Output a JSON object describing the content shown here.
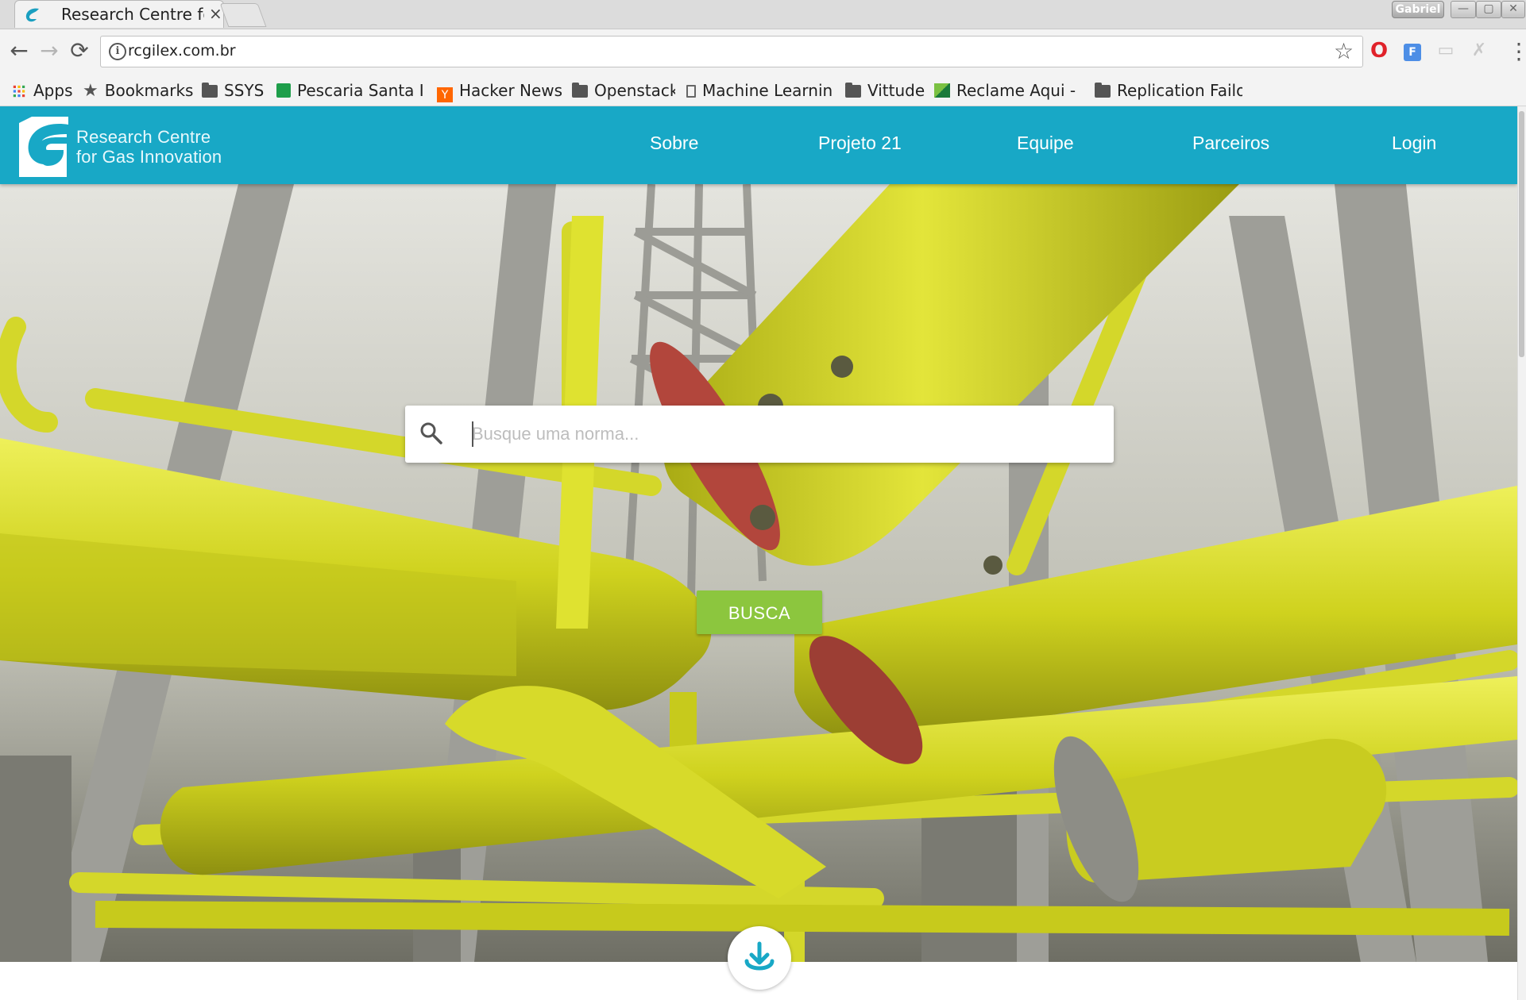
{
  "browser": {
    "tab_title": "Research Centre for",
    "tab_close": "×",
    "profile_name": "Gabriel",
    "window_buttons": [
      "—",
      "▢",
      "✕"
    ],
    "url": "rcgilex.com.br",
    "bookmarks": [
      {
        "label": "Apps",
        "icon": "apps-grid-icon"
      },
      {
        "label": "Bookmarks",
        "icon": "star-icon"
      },
      {
        "label": "SSYS",
        "icon": "folder-icon"
      },
      {
        "label": "Pescaria Santa I",
        "icon": "sheet-icon"
      },
      {
        "label": "Hacker News",
        "icon": "y-icon"
      },
      {
        "label": "Openstack",
        "icon": "folder-icon"
      },
      {
        "label": "Machine Learning",
        "icon": "page-icon"
      },
      {
        "label": "Vittude",
        "icon": "folder-icon"
      },
      {
        "label": "Reclame Aqui - S",
        "icon": "ra-icon"
      },
      {
        "label": "Replication Failo",
        "icon": "folder-icon"
      }
    ]
  },
  "site": {
    "logo_line1": "Research Centre",
    "logo_line2": "for Gas Innovation",
    "nav": [
      "Sobre",
      "Projeto 21",
      "Equipe",
      "Parceiros",
      "Login"
    ],
    "search_placeholder": "Busque uma norma...",
    "search_button": "BUSCA",
    "colors": {
      "header": "#18a8c6",
      "button": "#8cc63e",
      "pipes": "#d8dc2a"
    }
  }
}
